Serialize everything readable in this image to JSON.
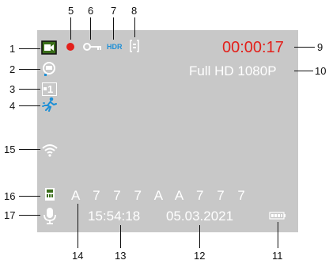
{
  "screen": {
    "timer": "00:00:17",
    "resolution": "Full HD 1080P",
    "plate": "A 7 7 7 A A 7 7 7",
    "time": "15:54:18",
    "date": "05.03.2021",
    "hdr_label": "HDR",
    "burst_label": "1"
  },
  "callouts": [
    "1",
    "2",
    "3",
    "4",
    "5",
    "6",
    "7",
    "8",
    "9",
    "10",
    "11",
    "12",
    "13",
    "14",
    "15",
    "16",
    "17"
  ],
  "colors": {
    "screen_bg": "#c8c8c8",
    "recording": "#e3201b",
    "accent_blue": "#1d8fd6",
    "icon_white": "#ffffff",
    "icon_green": "#3a6e1a"
  },
  "icons": [
    "video-mode-icon",
    "dashcam-icon",
    "burst-icon",
    "motion-detection-icon",
    "rec-dot-icon",
    "key-lock-icon",
    "hdr-icon",
    "gsensor-icon",
    "wifi-icon",
    "sd-card-icon",
    "microphone-icon",
    "battery-icon"
  ]
}
